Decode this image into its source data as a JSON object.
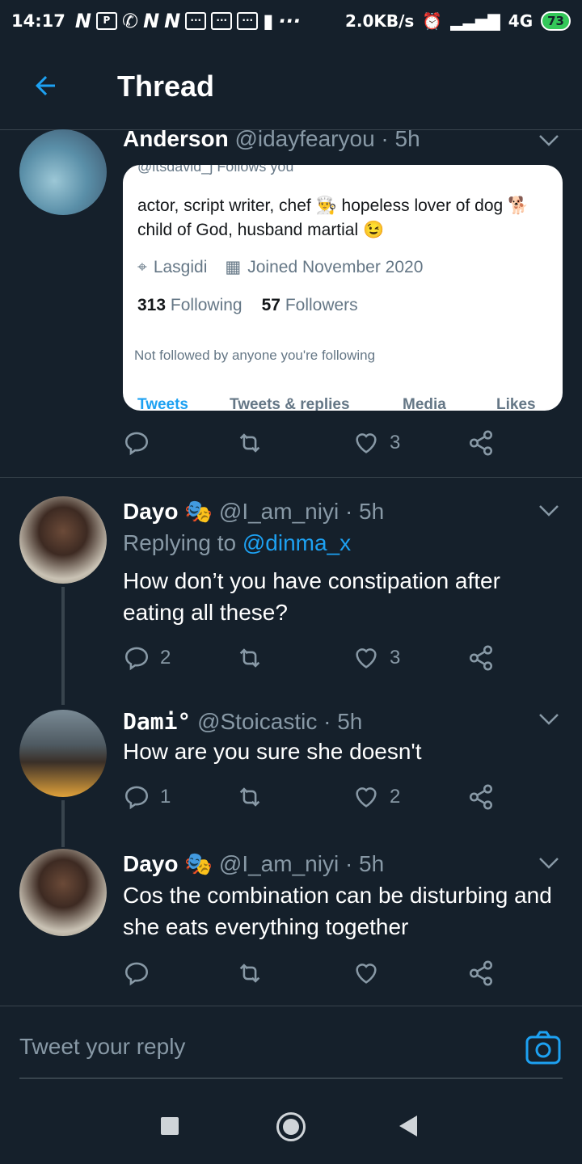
{
  "status_bar": {
    "time": "14:17",
    "net_speed": "2.0KB/s",
    "signal": "4G",
    "battery": "73"
  },
  "header": {
    "title": "Thread"
  },
  "tweets": [
    {
      "name": "Anderson",
      "handle": "@idayfearyou · 5h",
      "likes": "3",
      "card": {
        "cut_text": "@itsdavid_j  Follows you",
        "bio": "actor, script writer,  chef 👨‍🍳 hopeless lover of dog 🐕 child of God, husband martial 😉",
        "location": "Lasgidi",
        "joined": "Joined November 2020",
        "following_count": "313",
        "following_label": "Following",
        "followers_count": "57",
        "followers_label": "Followers",
        "not_followed": "Not followed by anyone you're following",
        "tabs": [
          "Tweets",
          "Tweets & replies",
          "Media",
          "Likes"
        ]
      }
    },
    {
      "name": "Dayo 🎭",
      "handle": "@I_am_niyi · 5h",
      "replying_label": "Replying to ",
      "replying_to": "@dinma_x",
      "text": "How don’t you have constipation after eating all these?",
      "replies": "2",
      "likes": "3"
    },
    {
      "name": "Dami°",
      "handle": "@Stoicastic · 5h",
      "text": "How are you sure she doesn't",
      "replies": "1",
      "likes": "2"
    },
    {
      "name": "Dayo 🎭",
      "handle": "@I_am_niyi · 5h",
      "text": "Cos the combination can be disturbing and she eats everything together",
      "replies": "",
      "likes": ""
    }
  ],
  "reply": {
    "placeholder": "Tweet your reply"
  },
  "colors": {
    "background": "#15202b",
    "accent": "#1da1f2",
    "muted": "#8899a6"
  }
}
